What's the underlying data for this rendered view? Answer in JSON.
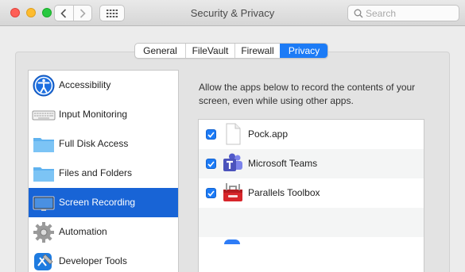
{
  "window": {
    "title": "Security & Privacy",
    "search_placeholder": "Search",
    "search_value": ""
  },
  "tabs": [
    {
      "label": "General",
      "active": false
    },
    {
      "label": "FileVault",
      "active": false
    },
    {
      "label": "Firewall",
      "active": false
    },
    {
      "label": "Privacy",
      "active": true
    }
  ],
  "categories": [
    {
      "label": "Accessibility",
      "icon": "accessibility-icon",
      "selected": false
    },
    {
      "label": "Input Monitoring",
      "icon": "keyboard-icon",
      "selected": false
    },
    {
      "label": "Full Disk Access",
      "icon": "folder-icon",
      "selected": false
    },
    {
      "label": "Files and Folders",
      "icon": "folder-icon",
      "selected": false
    },
    {
      "label": "Screen Recording",
      "icon": "display-icon",
      "selected": true
    },
    {
      "label": "Automation",
      "icon": "gear-icon",
      "selected": false
    },
    {
      "label": "Developer Tools",
      "icon": "xcode-icon",
      "selected": false
    }
  ],
  "panel": {
    "description": "Allow the apps below to record the contents of your screen, even while using other apps."
  },
  "apps": [
    {
      "label": "Pock.app",
      "icon": "document-icon",
      "checked": true
    },
    {
      "label": "Microsoft Teams",
      "icon": "teams-icon",
      "checked": true
    },
    {
      "label": "Parallels Toolbox",
      "icon": "toolbox-icon",
      "checked": true
    }
  ],
  "colors": {
    "accent": "#1c7bf6",
    "selection": "#1864d6"
  }
}
